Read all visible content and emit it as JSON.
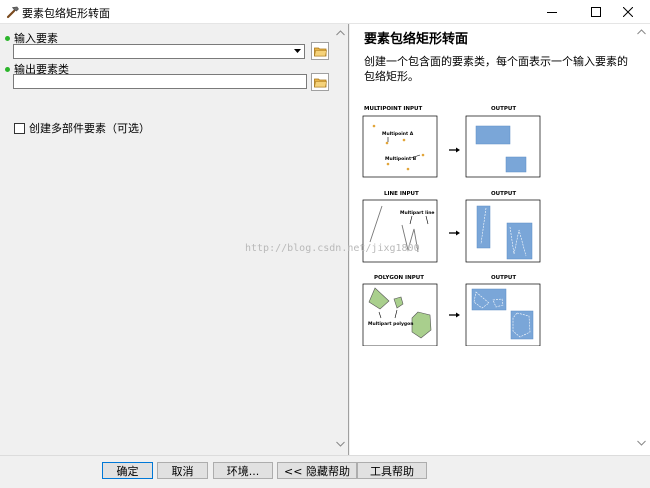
{
  "window": {
    "title": "要素包络矩形转面",
    "app_icon": "hammer-icon"
  },
  "form": {
    "input_label": "输入要素",
    "input_value": "",
    "output_label": "输出要素类",
    "output_value": "",
    "checkbox_label": "创建多部件要素（可选）",
    "checkbox_checked": false
  },
  "help": {
    "title": "要素包络矩形转面",
    "description": "创建一个包含面的要素类，每个面表示一个输入要素的包络矩形。",
    "diagram": {
      "multipoint_input": "MULTIPOINT INPUT",
      "output_label": "OUTPUT",
      "multipoint_a": "Multipoint A",
      "multipoint_b": "Multipoint B",
      "line_input": "LINE INPUT",
      "multipart_line": "Multipart line",
      "polygon_input": "POLYGON INPUT",
      "multipart_polygon": "Multipart polygon"
    },
    "watermark": "http://blog.csdn.net/jixg1800"
  },
  "buttons": {
    "ok": "确定",
    "cancel": "取消",
    "environments": "环境...",
    "hide_help": "<< 隐藏帮助",
    "tool_help": "工具帮助"
  },
  "colors": {
    "required_dot": "#2bb52b",
    "shape_fill_blue": "#7aa6d8",
    "polygon_fill_green": "#a9cf8d",
    "default_button_border": "#0078d7"
  }
}
